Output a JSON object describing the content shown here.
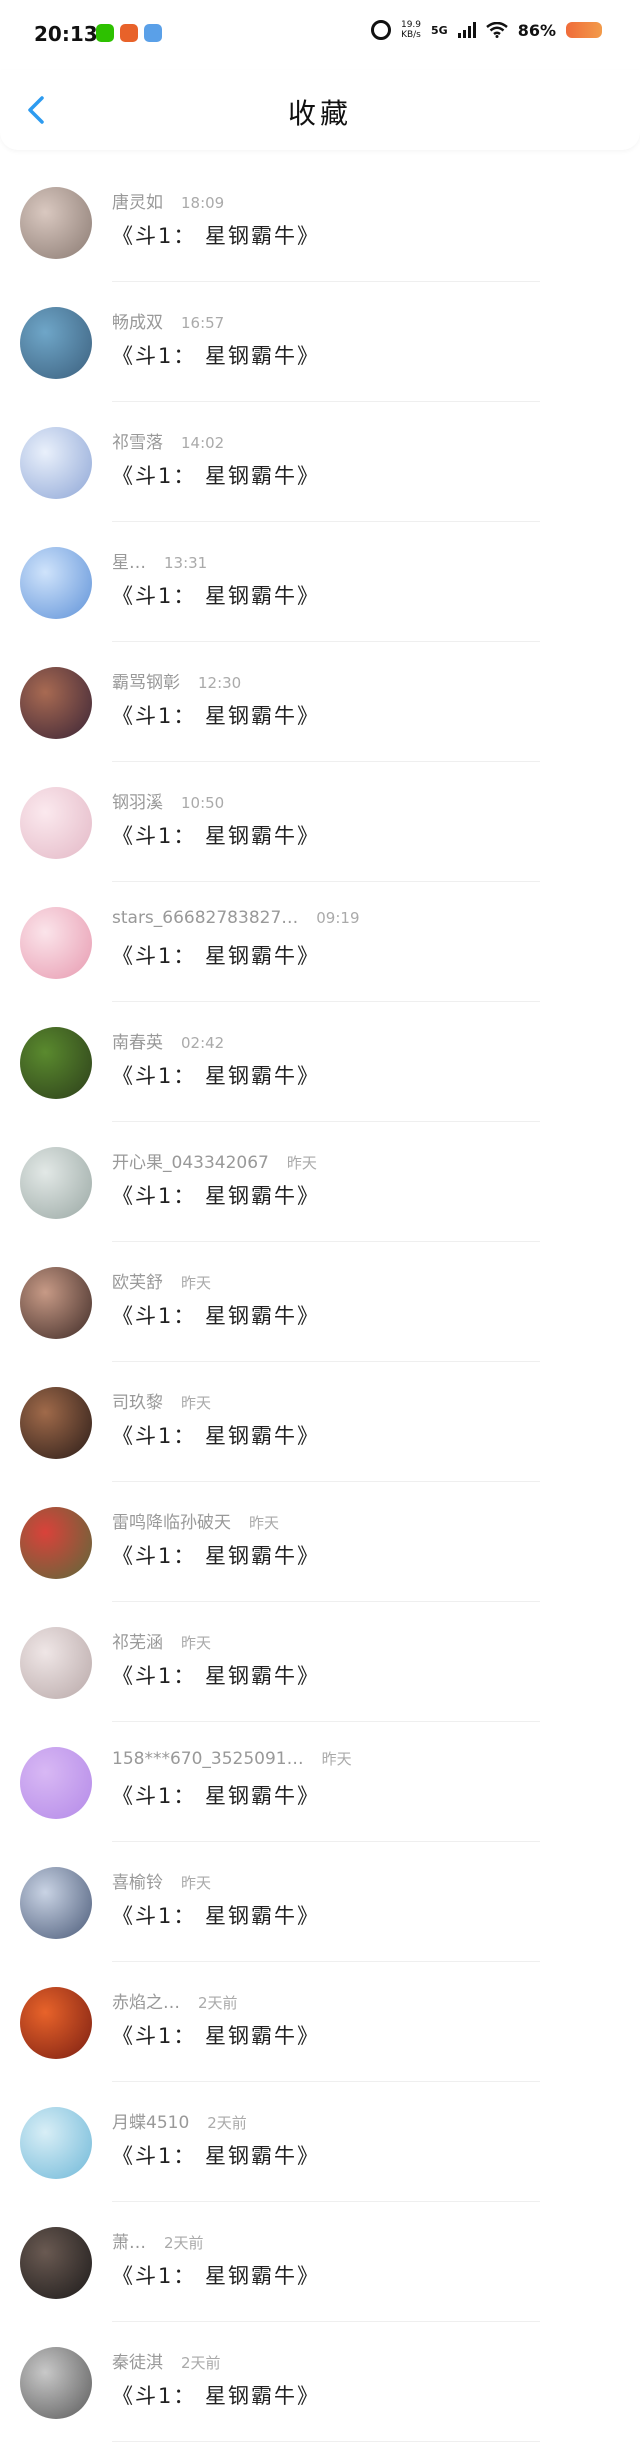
{
  "status_bar": {
    "time": "20:13",
    "net_speed_top": "19.9",
    "net_speed_bottom": "KB/s",
    "network": "5G",
    "battery": "86%",
    "app_icons": [
      {
        "name": "wechat-icon",
        "color": "#2dc100"
      },
      {
        "name": "pumpkin-app-icon",
        "color": "#e8622a"
      },
      {
        "name": "clock-app-icon",
        "color": "#5aa0e8"
      }
    ]
  },
  "header": {
    "title": "收藏",
    "back_icon": "chevron-left-icon",
    "accent_color": "#2d9bf0"
  },
  "items": [
    {
      "name": "唐灵如",
      "time": "18:09",
      "message": "《斗1： 星钢霸牛》",
      "avatar": [
        "#d9c8c0",
        "#8a7a72"
      ]
    },
    {
      "name": "畅成双",
      "time": "16:57",
      "message": "《斗1： 星钢霸牛》",
      "avatar": [
        "#6fa6c8",
        "#3b5f7d"
      ]
    },
    {
      "name": "祁雪落",
      "time": "14:02",
      "message": "《斗1： 星钢霸牛》",
      "avatar": [
        "#e9f0fb",
        "#8ea6d6"
      ]
    },
    {
      "name": "星…",
      "time": "13:31",
      "message": "《斗1： 星钢霸牛》",
      "avatar": [
        "#cfe3fb",
        "#5f92d8"
      ]
    },
    {
      "name": "霸骂钢彰",
      "time": "12:30",
      "message": "《斗1： 星钢霸牛》",
      "avatar": [
        "#a86a52",
        "#3a2436"
      ]
    },
    {
      "name": "钢羽溪",
      "time": "10:50",
      "message": "《斗1： 星钢霸牛》",
      "avatar": [
        "#fbe9ee",
        "#e3b8c6"
      ]
    },
    {
      "name": "stars_66682783827…",
      "time": "09:19",
      "message": "《斗1： 星钢霸牛》",
      "avatar": [
        "#fbe4ea",
        "#e79ab0"
      ]
    },
    {
      "name": "南春英",
      "time": "02:42",
      "message": "《斗1： 星钢霸牛》",
      "avatar": [
        "#5a8a2e",
        "#2c3e1a"
      ]
    },
    {
      "name": "开心果_043342067",
      "time": "昨天",
      "message": "《斗1： 星钢霸牛》",
      "avatar": [
        "#e2e8e6",
        "#9aa8a4"
      ]
    },
    {
      "name": "欧芙舒",
      "time": "昨天",
      "message": "《斗1： 星钢霸牛》",
      "avatar": [
        "#c79a86",
        "#3e2a26"
      ]
    },
    {
      "name": "司玖黎",
      "time": "昨天",
      "message": "《斗1： 星钢霸牛》",
      "avatar": [
        "#a06a4a",
        "#2a1c18"
      ]
    },
    {
      "name": "雷鸣降临孙破天",
      "time": "昨天",
      "message": "《斗1： 星钢霸牛》",
      "avatar": [
        "#d9423a",
        "#5a6a3a"
      ]
    },
    {
      "name": "祁芜涵",
      "time": "昨天",
      "message": "《斗1： 星钢霸牛》",
      "avatar": [
        "#efe6e6",
        "#b8a8a8"
      ]
    },
    {
      "name": "158***670_3525091…",
      "time": "昨天",
      "message": "《斗1： 星钢霸牛》",
      "avatar": [
        "#d8b8f4",
        "#b48ae8"
      ]
    },
    {
      "name": "喜榆铃",
      "time": "昨天",
      "message": "《斗1： 星钢霸牛》",
      "avatar": [
        "#c9d3e4",
        "#4a5a78"
      ]
    },
    {
      "name": "赤焰之…",
      "time": "2天前",
      "message": "《斗1： 星钢霸牛》",
      "avatar": [
        "#e8632a",
        "#7a1e12"
      ]
    },
    {
      "name": "月蝶4510",
      "time": "2天前",
      "message": "《斗1： 星钢霸牛》",
      "avatar": [
        "#d8eef6",
        "#6fb8d8"
      ]
    },
    {
      "name": "萧…",
      "time": "2天前",
      "message": "《斗1： 星钢霸牛》",
      "avatar": [
        "#6a5a52",
        "#1c1a1a"
      ]
    },
    {
      "name": "秦徒淇",
      "time": "2天前",
      "message": "《斗1： 星钢霸牛》",
      "avatar": [
        "#c8c8c8",
        "#5a5a5a"
      ]
    }
  ]
}
